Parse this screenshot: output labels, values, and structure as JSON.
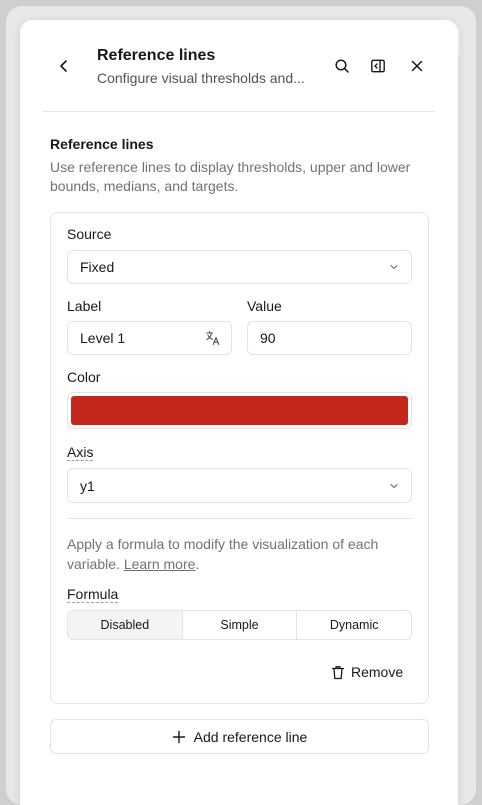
{
  "header": {
    "title": "Reference lines",
    "subtitle": "Configure visual thresholds and..."
  },
  "section": {
    "title": "Reference lines",
    "description": "Use reference lines to display thresholds, upper and lower bounds, medians, and targets."
  },
  "reference_line": {
    "source_label": "Source",
    "source_value": "Fixed",
    "label_label": "Label",
    "label_value": "Level 1",
    "value_label": "Value",
    "value_value": "90",
    "color_label": "Color",
    "color_value": "#c4281c",
    "axis_label": "Axis",
    "axis_value": "y1",
    "formula_desc_prefix": "Apply a formula to modify the visualization of each variable. ",
    "formula_desc_link": "Learn more",
    "formula_desc_suffix": ".",
    "formula_label": "Formula",
    "formula_options": [
      "Disabled",
      "Simple",
      "Dynamic"
    ],
    "formula_selected": "Disabled",
    "remove_label": "Remove"
  },
  "add_button_label": "Add reference line",
  "icons": [
    "chevron-left-icon",
    "search-icon",
    "sidebar-toggle-icon",
    "close-icon",
    "chevron-down-icon",
    "translate-icon",
    "trash-icon",
    "plus-icon"
  ]
}
